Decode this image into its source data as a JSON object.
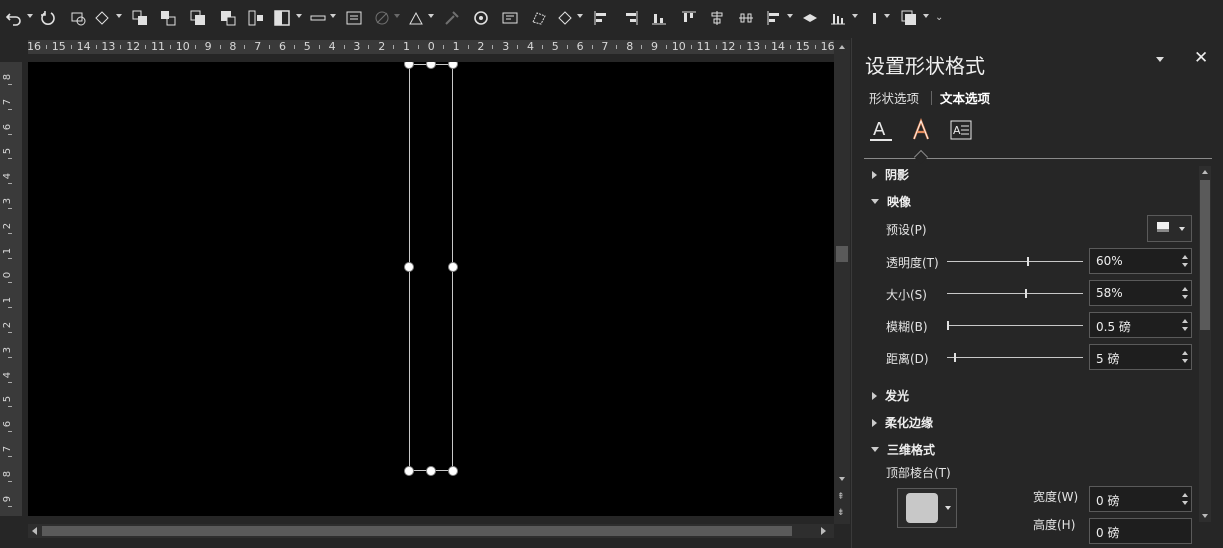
{
  "toolbar": {
    "icons": [
      "undo-icon",
      "redo-icon",
      "shape-arrange-icon",
      "edit-shape-icon",
      "bring-forward-icon",
      "send-backward-icon",
      "bring-front-icon",
      "send-back-icon",
      "group-icon",
      "fill-icon",
      "line-icon",
      "textbox-icon",
      "transparency-icon",
      "effects-icon",
      "format-painter-icon",
      "selection-icon",
      "screenshot-icon",
      "edit-points-icon",
      "change-shape-icon",
      "align-left-icon",
      "align-center-icon",
      "align-bottom-icon",
      "align-top-icon",
      "align-middle-icon",
      "distribute-icon",
      "align-icon",
      "rotate-icon",
      "chart-icon",
      "more-icon"
    ]
  },
  "ruler": {
    "h_labels": [
      "16",
      "15",
      "14",
      "13",
      "12",
      "11",
      "10",
      "9",
      "8",
      "7",
      "6",
      "5",
      "4",
      "3",
      "2",
      "1",
      "0",
      "1",
      "2",
      "3",
      "4",
      "5",
      "6",
      "7",
      "8",
      "9",
      "10",
      "11",
      "12",
      "13",
      "14",
      "15",
      "16"
    ],
    "v_labels": [
      "8",
      "7",
      "6",
      "5",
      "4",
      "3",
      "2",
      "1",
      "0",
      "1",
      "2",
      "3",
      "4",
      "5",
      "6",
      "7",
      "8",
      "9"
    ]
  },
  "panel": {
    "title": "设置形状格式",
    "tab_shape": "形状选项",
    "tab_text": "文本选项",
    "icons": [
      "text-fill-icon",
      "text-effects-icon",
      "textbox-layout-icon"
    ],
    "sections": {
      "shadow": "阴影",
      "reflection": "映像",
      "glow": "发光",
      "soft_edges": "柔化边缘",
      "three_d": "三维格式"
    },
    "preset_label": "预设(P)",
    "transparency": {
      "label": "透明度(T)",
      "value": "60%",
      "level": 0.6
    },
    "size": {
      "label": "大小(S)",
      "value": "58%",
      "level": 0.58
    },
    "blur": {
      "label": "模糊(B)",
      "value": "0.5 磅",
      "level": 0.0
    },
    "distance": {
      "label": "距离(D)",
      "value": "5 磅",
      "level": 0.05
    },
    "top_bevel_label": "顶部棱台(T)",
    "width": {
      "label": "宽度(W)",
      "value": "0 磅"
    },
    "height": {
      "label": "高度(H)",
      "value": "0 磅"
    }
  }
}
